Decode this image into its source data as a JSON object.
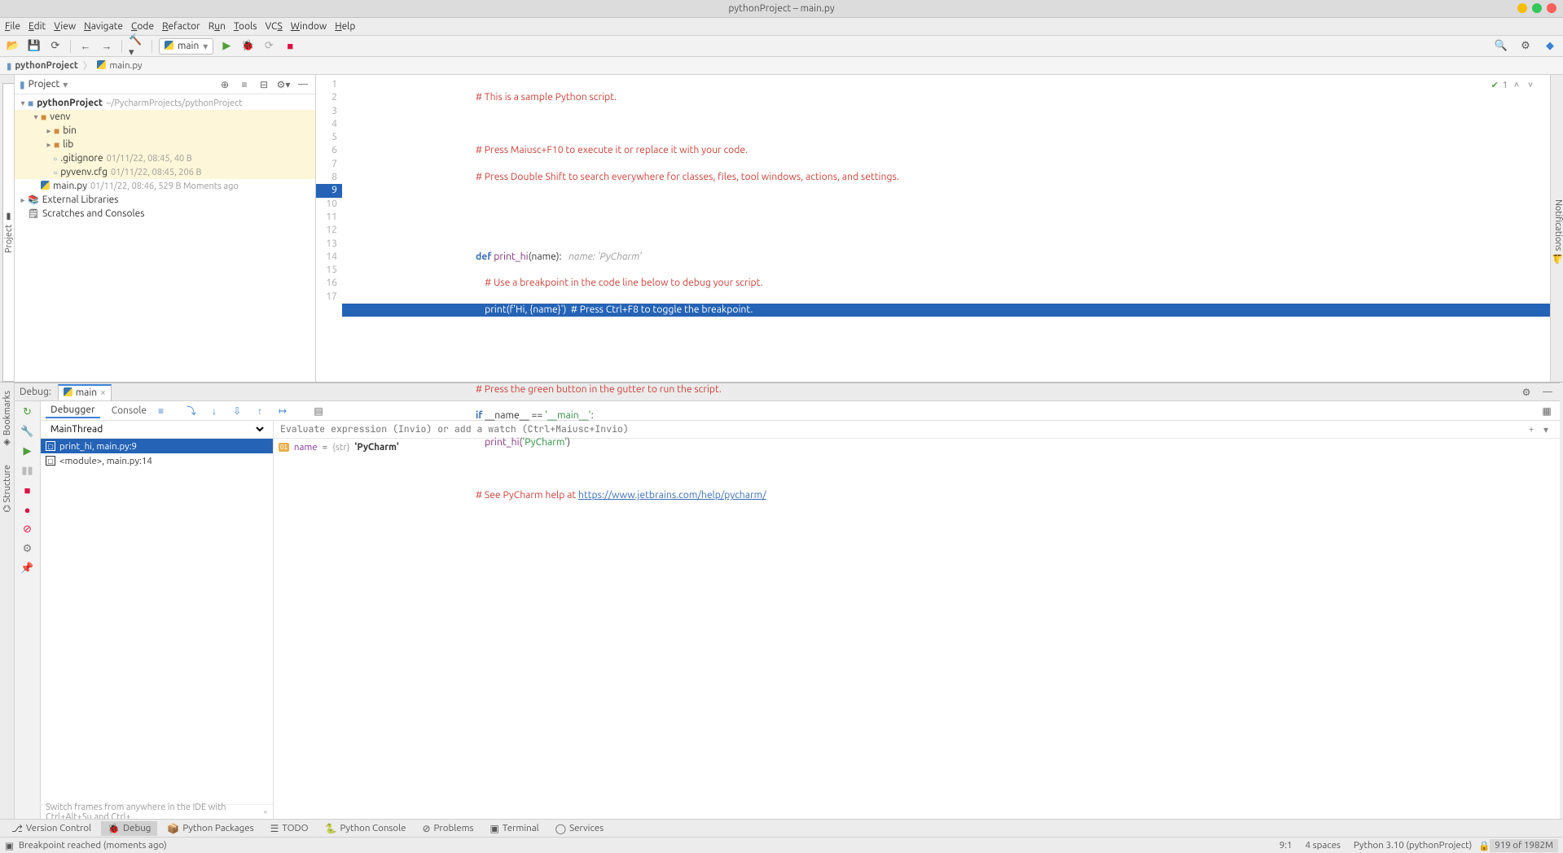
{
  "window": {
    "title": "pythonProject – main.py"
  },
  "menu": [
    "File",
    "Edit",
    "View",
    "Navigate",
    "Code",
    "Refactor",
    "Run",
    "Tools",
    "VCS",
    "Window",
    "Help"
  ],
  "toolbar": {
    "run_config": "main"
  },
  "breadcrumbs": [
    {
      "label": "pythonProject",
      "icon": "project"
    },
    {
      "label": "main.py",
      "icon": "python"
    }
  ],
  "left_tabs": {
    "project": "Project"
  },
  "right_tabs": {
    "notifications": "Notifications"
  },
  "side_v_tabs": {
    "bookmarks": "Bookmarks",
    "structure": "Structure"
  },
  "project_tool": {
    "title": "Project",
    "tree": {
      "root": {
        "name": "pythonProject",
        "path": "~/PycharmProjects/pythonProject"
      },
      "venv": {
        "name": "venv"
      },
      "bin": {
        "name": "bin"
      },
      "lib": {
        "name": "lib"
      },
      "gitignore": {
        "name": ".gitignore",
        "meta": "01/11/22, 08:45, 40 B"
      },
      "pyvenv": {
        "name": "pyvenv.cfg",
        "meta": "01/11/22, 08:45, 206 B"
      },
      "mainpy": {
        "name": "main.py",
        "meta": "01/11/22, 08:46, 529 B Moments ago"
      },
      "extlib": {
        "name": "External Libraries"
      },
      "scratch": {
        "name": "Scratches and Consoles"
      }
    }
  },
  "editor": {
    "problems_count": "1",
    "lines": {
      "l1": "# This is a sample Python script.",
      "l3": "# Press Maiusc+F10 to execute it or replace it with your code.",
      "l4": "# Press Double Shift to search everywhere for classes, files, tool windows, actions, and settings.",
      "l7def": "def ",
      "l7fn": "print_hi",
      "l7sig": "(name):",
      "l7hint": "   name: 'PyCharm'",
      "l8": "    # Use a breakpoint in the code line below to debug your script.",
      "l9a": "    print(",
      "l9s": "f'Hi, {name}'",
      "l9b": ")  ",
      "l9c": "# Press Ctrl+F8 to toggle the breakpoint.",
      "l12": "# Press the green button in the gutter to run the script.",
      "l13a": "if ",
      "l13b": "__name__ == ",
      "l13c": "'__main__'",
      "l13d": ":",
      "l14a": "    print_hi(",
      "l14b": "'PyCharm'",
      "l14c": ")",
      "l16a": "# See PyCharm help at ",
      "l16b": "https://www.jetbrains.com/help/pycharm/"
    }
  },
  "debug": {
    "label": "Debug:",
    "tab": "main",
    "subtabs": {
      "debugger": "Debugger",
      "console": "Console"
    },
    "thread": "MainThread",
    "frames": [
      {
        "label": "print_hi, main.py:9",
        "selected": true
      },
      {
        "label": "<module>, main.py:14",
        "selected": false
      }
    ],
    "frames_hint": "Switch frames from anywhere in the IDE with Ctrl+Alt+Su and Ctrl+...",
    "eval_placeholder": "Evaluate expression (Invio) or add a watch (Ctrl+Maiusc+Invio)",
    "vars": [
      {
        "badge": "01",
        "name": "name",
        "eq": " = ",
        "type": "{str} ",
        "value": "'PyCharm'"
      }
    ]
  },
  "bottom": {
    "version_control": "Version Control",
    "debug": "Debug",
    "python_packages": "Python Packages",
    "todo": "TODO",
    "python_console": "Python Console",
    "problems": "Problems",
    "terminal": "Terminal",
    "services": "Services"
  },
  "status": {
    "msg": "Breakpoint reached (moments ago)",
    "pos": "9:1",
    "indent": "4 spaces",
    "interp": "Python 3.10 (pythonProject)",
    "mem": "919 of 1982M"
  }
}
